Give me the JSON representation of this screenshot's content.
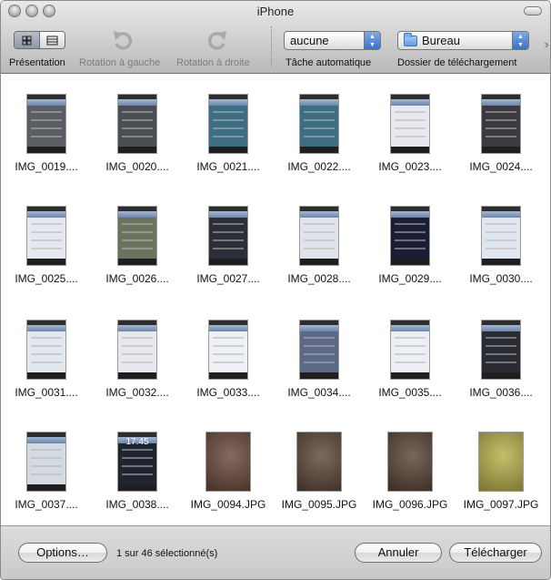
{
  "window": {
    "title": "iPhone"
  },
  "toolbar": {
    "presentation_label": "Présentation",
    "rotate_left_label": "Rotation à gauche",
    "rotate_right_label": "Rotation à droite",
    "auto_task": {
      "value": "aucune",
      "label": "Tâche automatique"
    },
    "download_folder": {
      "value": "Bureau",
      "label": "Dossier de téléchargement"
    }
  },
  "images": [
    {
      "name": "IMG_0019....",
      "color": "#5a5e63"
    },
    {
      "name": "IMG_0020....",
      "color": "#4a4d52"
    },
    {
      "name": "IMG_0021....",
      "color": "#3d6e84"
    },
    {
      "name": "IMG_0022....",
      "color": "#3d6e84"
    },
    {
      "name": "IMG_0023....",
      "color": "#e7e9ee"
    },
    {
      "name": "IMG_0024....",
      "color": "#3b3b3f"
    },
    {
      "name": "IMG_0025....",
      "color": "#e5e8ee"
    },
    {
      "name": "IMG_0026....",
      "color": "#6b735f"
    },
    {
      "name": "IMG_0027....",
      "color": "#2c2f38"
    },
    {
      "name": "IMG_0028....",
      "color": "#dfe3ea"
    },
    {
      "name": "IMG_0029....",
      "color": "#1a1d33"
    },
    {
      "name": "IMG_0030....",
      "color": "#dfe6f0"
    },
    {
      "name": "IMG_0031....",
      "color": "#e3e7ee"
    },
    {
      "name": "IMG_0032....",
      "color": "#e6e8ed"
    },
    {
      "name": "IMG_0033....",
      "color": "#edf0f5"
    },
    {
      "name": "IMG_0034....",
      "color": "#5c6a88"
    },
    {
      "name": "IMG_0035....",
      "color": "#eceff4"
    },
    {
      "name": "IMG_0036....",
      "color": "#2a2c33"
    },
    {
      "name": "IMG_0037....",
      "color": "#d4dae4"
    },
    {
      "name": "IMG_0038....",
      "color": "#1e2430"
    },
    {
      "name": "IMG_0094.JPG",
      "color": "#6b4a3a"
    },
    {
      "name": "IMG_0095.JPG",
      "color": "#5e4838"
    },
    {
      "name": "IMG_0096.JPG",
      "color": "#5a4436"
    },
    {
      "name": "IMG_0097.JPG",
      "color": "#b9b14a"
    }
  ],
  "lockscreen_time": "17:45",
  "footer": {
    "options_label": "Options…",
    "status": "1 sur 46 sélectionné(s)",
    "cancel_label": "Annuler",
    "download_label": "Télécharger"
  }
}
